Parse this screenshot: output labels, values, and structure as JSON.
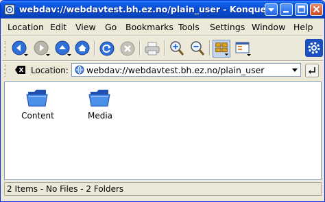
{
  "window": {
    "title": "webdav://webdavtest.bh.ez.no/plain_user - Konquer"
  },
  "menu": {
    "items": [
      "Location",
      "Edit",
      "View",
      "Go",
      "Bookmarks",
      "Tools",
      "Settings",
      "Window",
      "Help"
    ]
  },
  "toolbar": {
    "icons": [
      "back-icon",
      "forward-icon",
      "up-icon",
      "home-icon",
      "reload-icon",
      "stop-icon",
      "print-icon",
      "zoom-in-icon",
      "zoom-out-icon",
      "icon-view-icon",
      "split-view-icon",
      "konqueror-gear-icon"
    ]
  },
  "location": {
    "label": "Location:",
    "value": "webdav://webdavtest.bh.ez.no/plain_user"
  },
  "files": [
    {
      "name": "Content",
      "type": "folder"
    },
    {
      "name": "Media",
      "type": "folder"
    }
  ],
  "status": {
    "text": "2 Items - No Files - 2 Folders"
  },
  "colors": {
    "titlebar": "#0a4ed4",
    "window_bg": "#ece9d8",
    "folder": "#3a7be0"
  }
}
